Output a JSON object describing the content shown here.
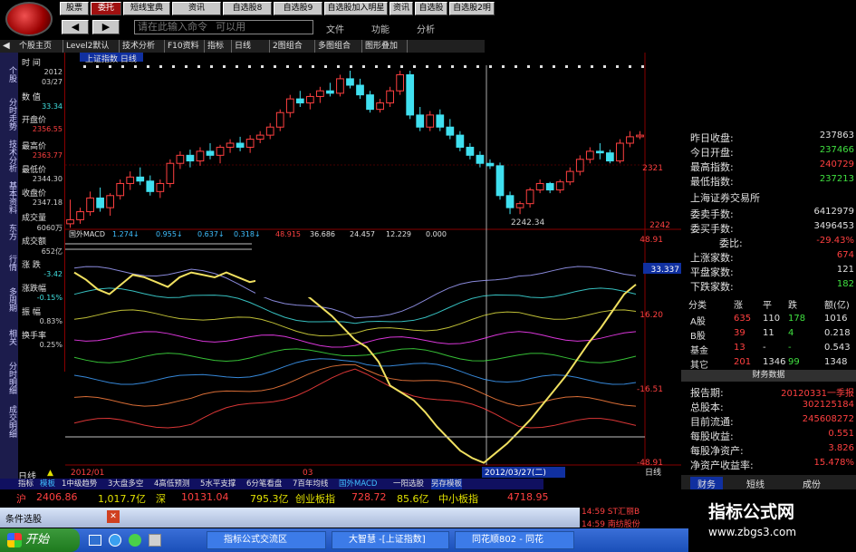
{
  "toolbar": {
    "row1": [
      "股票",
      "委托",
      "短线宝典",
      "资讯",
      "自选股8",
      "自选股9",
      "自选股加入明星",
      "资讯",
      "自选股",
      "自选股2明"
    ],
    "input_placeholder": "请在此输入命令   可以用",
    "menus": [
      "文件",
      "功能",
      "分析"
    ]
  },
  "tabs": [
    "个股主页",
    "Level2默认",
    "技术分析",
    "F10资料",
    "指标",
    "日线",
    "2图组合",
    "多图组合",
    "图形叠加"
  ],
  "left_tabs": [
    "个股",
    "分时走势",
    "技术分析",
    "基本资料",
    "东方",
    "行情",
    "多周期",
    "相关",
    "分时明细",
    "成交明细"
  ],
  "chart_title": "上证指数 日线",
  "info": {
    "labels": [
      "时 间",
      "数 值",
      "开盘价",
      "最高价",
      "最低价",
      "收盘价",
      "成交量",
      "成交额",
      "涨 跌",
      "涨跌幅",
      "振 幅",
      "换手率"
    ],
    "time": "2012",
    "date": "03/27",
    "value": "33.34",
    "open": "2356.55",
    "high": "2363.77",
    "low": "2344.30",
    "close": "2347.18",
    "volume": "6060万",
    "amount": "652亿",
    "change": "-3.42",
    "pct": "-0.15%",
    "amp": "0.83%",
    "turn": "0.25%"
  },
  "price_axis": {
    "top": "2321",
    "bottom": "2242",
    "low_label": "2242.34"
  },
  "macd_label": "国外MACD",
  "macd_values": [
    "1.274↓",
    "0.955↓",
    "0.637↓",
    "0.318↓",
    "48.915",
    "36.686",
    "24.457",
    "12.229",
    "0.000"
  ],
  "macd_axis": [
    "48.91",
    "33.337",
    "16.20",
    "-16.51",
    "-48.91"
  ],
  "x_axis": [
    "2012/01",
    "03",
    "2012/03/27(二)"
  ],
  "bottom_tabs": [
    "指标",
    "模板",
    "1中级趋势",
    "3大盘多空",
    "4高低预测",
    "5水平支撑",
    "6分笔看盘",
    "7百年均线",
    "国外MACD",
    "一阳选股",
    "另存模板"
  ],
  "period": "日线",
  "quote": {
    "sh": "沪",
    "sh_val": "2406.86",
    "sh_amt": "1,017.7亿",
    "sz": "深",
    "sz_val": "10131.04",
    "sz_amt": "795.3亿",
    "cyb": "创业板指",
    "cyb_val": "728.72",
    "cyb_amt": "85.6亿",
    "zxb": "中小板指",
    "zxb_val": "4718.95"
  },
  "right": {
    "rows": [
      [
        "昨日收盘:",
        "237863"
      ],
      [
        "今日开盘:",
        "237466"
      ],
      [
        "最高指数:",
        "240729"
      ],
      [
        "最低指数:",
        "237213"
      ]
    ],
    "exchange": "上海证券交易所",
    "rows2": [
      [
        "委卖手数:",
        "6412979"
      ],
      [
        "委买手数:",
        "3496453"
      ],
      [
        "委比:",
        "-29.43%"
      ],
      [
        "上涨家数:",
        "674"
      ],
      [
        "平盘家数:",
        "121"
      ],
      [
        "下跌家数:",
        "182"
      ]
    ],
    "table_head": [
      "分类",
      "涨",
      "平",
      "跌",
      "额(亿)"
    ],
    "table": [
      [
        "A股",
        "635",
        "110",
        "178",
        "1016"
      ],
      [
        "B股",
        "39",
        "11",
        "4",
        "0.218"
      ],
      [
        "基金",
        "13",
        "-",
        "-",
        "0.543"
      ],
      [
        "其它",
        "201",
        "1346",
        "99",
        "1348"
      ]
    ],
    "fin_title": "财务数据",
    "fin": [
      [
        "报告期:",
        "20120331一季报"
      ],
      [
        "总股本:",
        "302125184"
      ],
      [
        "目前流通:",
        "245608272"
      ],
      [
        "每股收益:",
        "0.551"
      ],
      [
        "每股净资产:",
        "3.826"
      ],
      [
        "净资产收益率:",
        "15.478%"
      ]
    ],
    "tabs": [
      "财务",
      "短线",
      "成份"
    ]
  },
  "news": [
    "14:59 ST汇丽B",
    "14:59 南纺股份"
  ],
  "cond_label": "条件选股",
  "taskbar": {
    "start": "开始",
    "tasks": [
      "指标公式交流区",
      "大智慧 -[上证指数]",
      "同花顺802 - 同花"
    ]
  },
  "banner": {
    "title": "指标公式网",
    "url": "www.zbgs3.com"
  },
  "chart_data": {
    "type": "candlestick",
    "candles": [
      [
        2230,
        2260,
        2225,
        2235
      ],
      [
        2235,
        2250,
        2230,
        2245
      ],
      [
        2245,
        2270,
        2240,
        2262
      ],
      [
        2262,
        2275,
        2245,
        2250
      ],
      [
        2250,
        2268,
        2240,
        2265
      ],
      [
        2265,
        2285,
        2260,
        2280
      ],
      [
        2280,
        2295,
        2272,
        2288
      ],
      [
        2288,
        2300,
        2278,
        2283
      ],
      [
        2283,
        2290,
        2265,
        2270
      ],
      [
        2270,
        2285,
        2262,
        2280
      ],
      [
        2280,
        2310,
        2275,
        2305
      ],
      [
        2305,
        2320,
        2298,
        2315
      ],
      [
        2315,
        2322,
        2300,
        2308
      ],
      [
        2308,
        2325,
        2302,
        2320
      ],
      [
        2320,
        2330,
        2310,
        2315
      ],
      [
        2315,
        2328,
        2305,
        2325
      ],
      [
        2325,
        2335,
        2318,
        2330
      ],
      [
        2330,
        2338,
        2320,
        2325
      ],
      [
        2325,
        2340,
        2318,
        2335
      ],
      [
        2335,
        2345,
        2330,
        2340
      ],
      [
        2340,
        2355,
        2335,
        2350
      ],
      [
        2350,
        2372,
        2345,
        2368
      ],
      [
        2368,
        2390,
        2362,
        2385
      ],
      [
        2385,
        2395,
        2375,
        2380
      ],
      [
        2380,
        2392,
        2372,
        2388
      ],
      [
        2388,
        2400,
        2380,
        2395
      ],
      [
        2395,
        2405,
        2388,
        2392
      ],
      [
        2392,
        2415,
        2388,
        2410
      ],
      [
        2410,
        2420,
        2398,
        2402
      ],
      [
        2402,
        2410,
        2385,
        2390
      ],
      [
        2390,
        2395,
        2368,
        2372
      ],
      [
        2372,
        2385,
        2368,
        2380
      ],
      [
        2380,
        2400,
        2375,
        2395
      ],
      [
        2395,
        2420,
        2390,
        2415
      ],
      [
        2415,
        2420,
        2360,
        2365
      ],
      [
        2365,
        2375,
        2345,
        2350
      ],
      [
        2350,
        2370,
        2345,
        2365
      ],
      [
        2365,
        2372,
        2345,
        2350
      ],
      [
        2350,
        2360,
        2335,
        2340
      ],
      [
        2340,
        2345,
        2320,
        2325
      ],
      [
        2325,
        2330,
        2310,
        2315
      ],
      [
        2315,
        2320,
        2300,
        2305
      ],
      [
        2305,
        2310,
        2298,
        2302
      ],
      [
        2302,
        2306,
        2260,
        2265
      ],
      [
        2265,
        2270,
        2242,
        2250
      ],
      [
        2250,
        2258,
        2242,
        2255
      ],
      [
        2255,
        2275,
        2250,
        2272
      ],
      [
        2272,
        2285,
        2268,
        2280
      ],
      [
        2280,
        2282,
        2268,
        2272
      ],
      [
        2272,
        2285,
        2268,
        2282
      ],
      [
        2282,
        2300,
        2278,
        2295
      ],
      [
        2295,
        2315,
        2290,
        2310
      ],
      [
        2310,
        2325,
        2305,
        2320
      ],
      [
        2320,
        2330,
        2310,
        2318
      ],
      [
        2318,
        2322,
        2305,
        2308
      ],
      [
        2308,
        2335,
        2305,
        2330
      ],
      [
        2330,
        2345,
        2325,
        2338
      ],
      [
        2338,
        2345,
        2335,
        2340
      ]
    ],
    "macd_yellow": [
      31,
      28,
      24,
      22,
      26,
      30,
      29,
      27,
      25,
      29,
      31,
      30,
      29,
      31,
      29,
      27,
      28,
      26,
      24,
      23,
      21,
      17,
      13,
      8,
      3,
      0,
      -6,
      -16,
      -19,
      -22,
      -27,
      -33,
      -38,
      -43,
      -46,
      -48,
      -44,
      -40,
      -35,
      -30,
      -24,
      -18,
      -12,
      -5,
      2,
      8,
      15,
      22,
      26
    ],
    "ylim": [
      2240,
      2420
    ],
    "macd_ylim": [
      -48.91,
      48.91
    ]
  }
}
